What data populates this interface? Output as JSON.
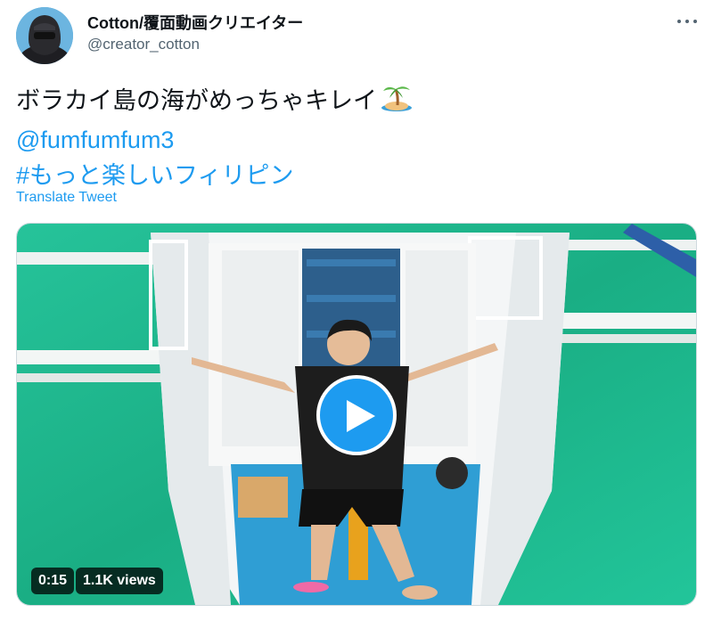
{
  "author": {
    "display_name": "Cotton/覆面動画クリエイター",
    "handle": "@creator_cotton",
    "avatar_icon": "masked-person-avatar"
  },
  "more_icon": "more-horizontal-icon",
  "tweet": {
    "text_line1": "ボラカイ島の海がめっちゃキレイ",
    "emoji_icon": "desert-island-icon",
    "mention": "@fumfumfum3",
    "hashtag": "#もっと楽しいフィリピン",
    "translate_label": "Translate Tweet"
  },
  "video": {
    "duration": "0:15",
    "views": "1.1K views",
    "play_icon": "play-icon",
    "colors": {
      "water": "#1fb98c",
      "boat": "#f2f5f6",
      "play": "#1d9bf0"
    }
  },
  "colors": {
    "link": "#1d9bf0",
    "text": "#0f1419",
    "secondary": "#536471"
  }
}
